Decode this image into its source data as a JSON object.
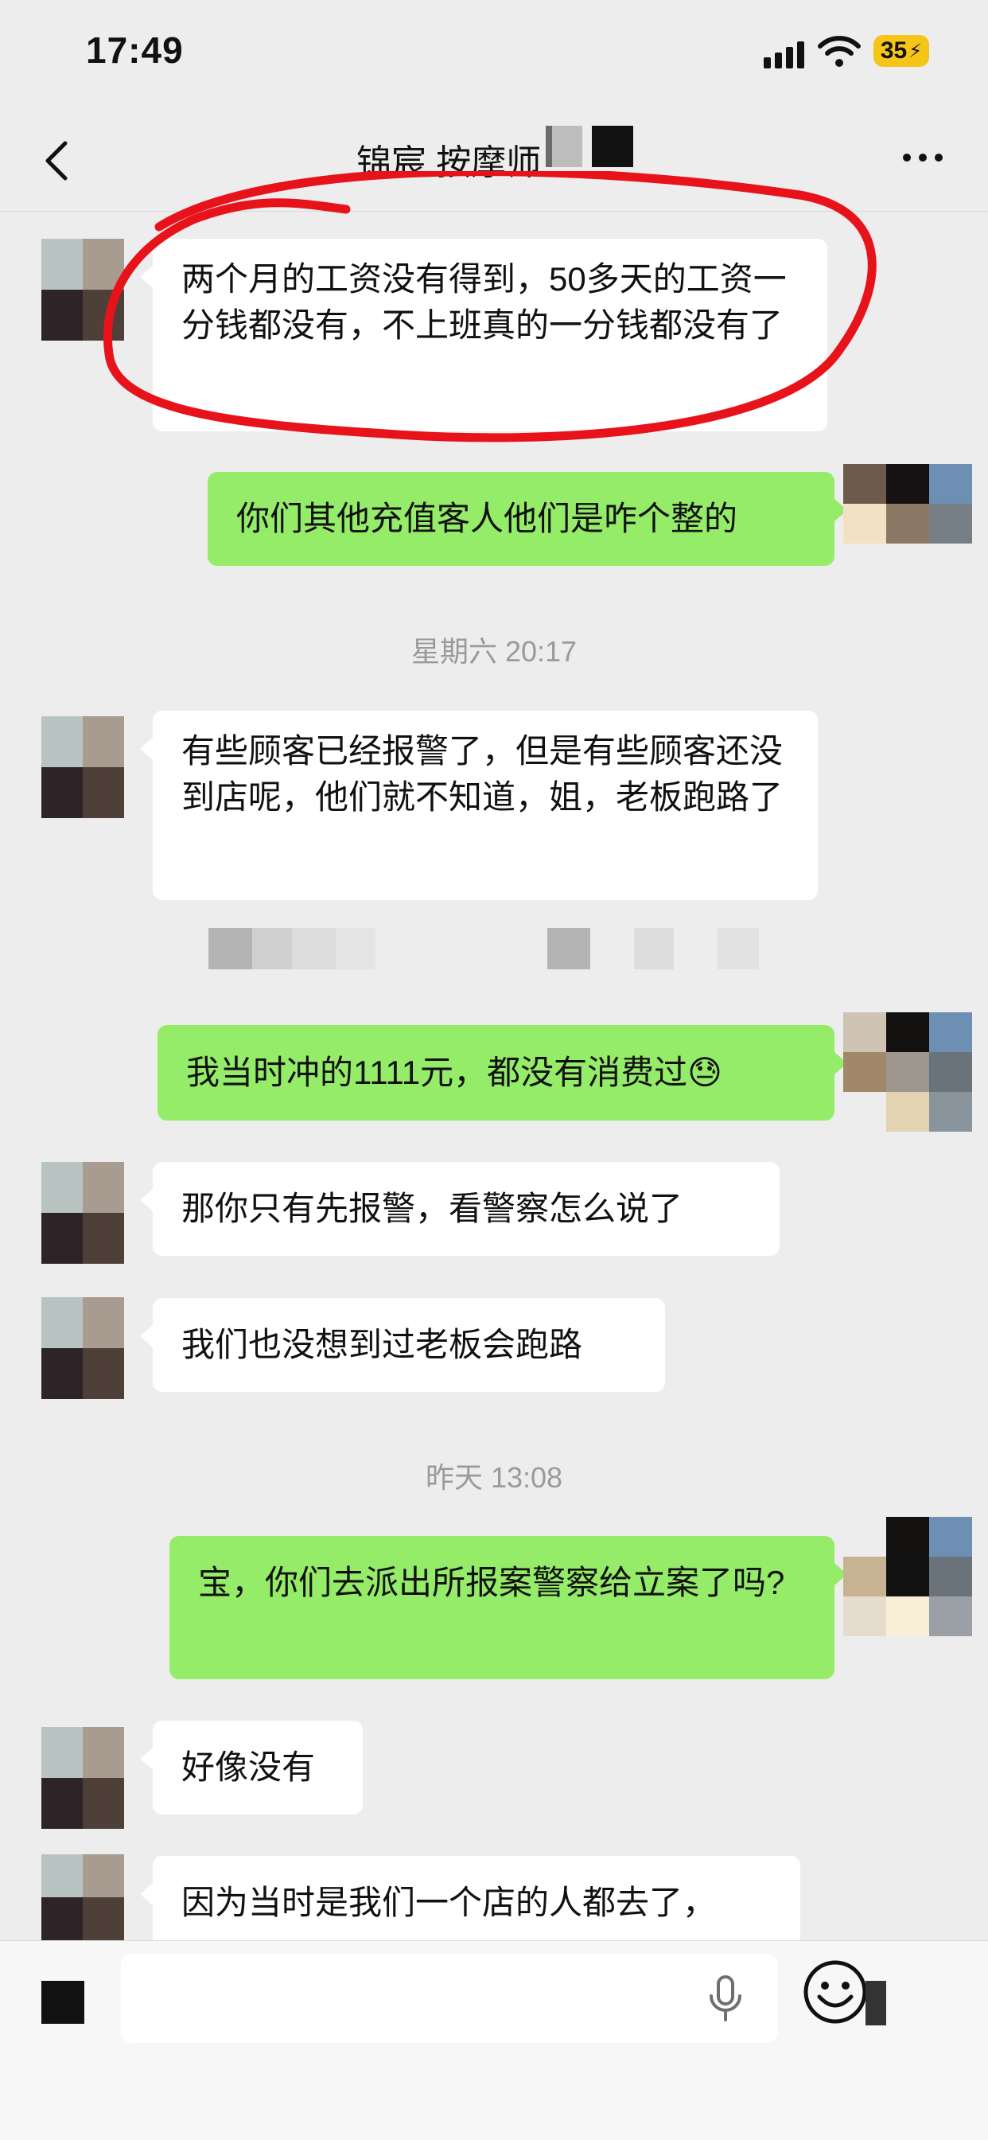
{
  "status_bar": {
    "time": "17:49",
    "battery": "35"
  },
  "header": {
    "title": "锦宸 按摩师"
  },
  "messages": [
    {
      "side": "in",
      "text": "两个月的工资没有得到，50多天的工资一分钱都没有，不上班真的一分钱都没有了"
    },
    {
      "side": "out",
      "text": "你们其他充值客人他们是咋个整的"
    },
    {
      "side": "in",
      "text": "有些顾客已经报警了，但是有些顾客还没到店呢，他们就不知道，姐，老板跑路了"
    },
    {
      "side": "out",
      "text": "我当时冲的1111元，都没有消费过"
    },
    {
      "side": "in",
      "text": "那你只有先报警，看警察怎么说了"
    },
    {
      "side": "in",
      "text": "我们也没想到过老板会跑路"
    },
    {
      "side": "out",
      "text": "宝，你们去派出所报案警察给立案了吗?"
    },
    {
      "side": "in",
      "text": "好像没有"
    },
    {
      "side": "in",
      "text": "因为当时是我们一个店的人都去了，"
    }
  ],
  "timestamps": [
    "星期六 20:17",
    "昨天 13:08"
  ],
  "emoji": "😓",
  "input": {
    "placeholder": ""
  },
  "icons": {
    "back": "chevron-left-icon",
    "more": "more-dots-icon",
    "mic": "microphone-icon",
    "emoji": "smiley-icon",
    "signal": "signal-bars-icon",
    "wifi": "wifi-icon"
  },
  "colors": {
    "outgoing_bubble": "#95ec69",
    "incoming_bubble": "#ffffff",
    "background": "#ededed",
    "highlight_circle": "#e8121b",
    "battery": "#f5c518"
  }
}
